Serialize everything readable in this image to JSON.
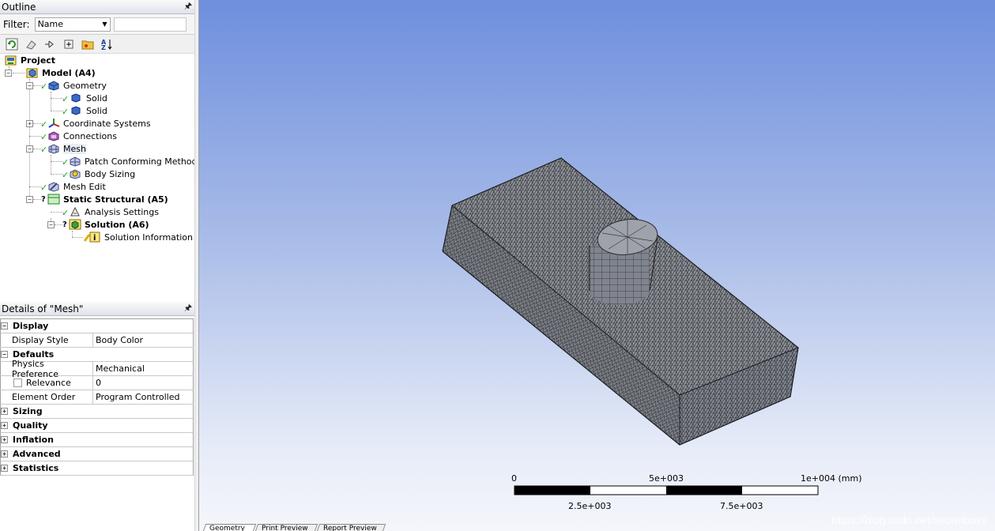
{
  "outline": {
    "title": "Outline",
    "filter_label": "Filter:",
    "filter_value": "Name",
    "filter_text": ""
  },
  "tree": [
    {
      "label": "Project",
      "bold": true,
      "icon": "project-icon"
    },
    {
      "label": "Model (A4)",
      "bold": true,
      "icon": "model-icon"
    },
    {
      "label": "Geometry",
      "bold": false,
      "icon": "geometry-icon"
    },
    {
      "label": "Solid",
      "bold": false,
      "icon": "solid-body-icon"
    },
    {
      "label": "Solid",
      "bold": false,
      "icon": "solid-body-icon"
    },
    {
      "label": "Coordinate Systems",
      "bold": false,
      "icon": "coordinate-systems-icon"
    },
    {
      "label": "Connections",
      "bold": false,
      "icon": "connections-icon"
    },
    {
      "label": "Mesh",
      "bold": false,
      "icon": "mesh-icon"
    },
    {
      "label": "Patch Conforming Method",
      "bold": false,
      "icon": "mesh-method-icon"
    },
    {
      "label": "Body Sizing",
      "bold": false,
      "icon": "body-sizing-icon"
    },
    {
      "label": "Mesh Edit",
      "bold": false,
      "icon": "mesh-edit-icon"
    },
    {
      "label": "Static Structural (A5)",
      "bold": true,
      "icon": "static-structural-icon"
    },
    {
      "label": "Analysis Settings",
      "bold": false,
      "icon": "analysis-settings-icon"
    },
    {
      "label": "Solution (A6)",
      "bold": true,
      "icon": "solution-icon"
    },
    {
      "label": "Solution Information",
      "bold": false,
      "icon": "solution-information-icon"
    }
  ],
  "details": {
    "title": "Details of \"Mesh\"",
    "rows": [
      {
        "kind": "category",
        "label": "Display",
        "expanded": true
      },
      {
        "kind": "prop",
        "label": "Display Style",
        "value": "Body Color"
      },
      {
        "kind": "category",
        "label": "Defaults",
        "expanded": true
      },
      {
        "kind": "prop",
        "label": "Physics Preference",
        "value": "Mechanical"
      },
      {
        "kind": "prop-check",
        "label": "Relevance",
        "value": "0"
      },
      {
        "kind": "prop",
        "label": "Element Order",
        "value": "Program Controlled"
      },
      {
        "kind": "category",
        "label": "Sizing",
        "expanded": false
      },
      {
        "kind": "category",
        "label": "Quality",
        "expanded": false
      },
      {
        "kind": "category",
        "label": "Inflation",
        "expanded": false
      },
      {
        "kind": "category",
        "label": "Advanced",
        "expanded": false
      },
      {
        "kind": "category",
        "label": "Statistics",
        "expanded": false
      }
    ]
  },
  "scale_bar": {
    "top_labels": [
      "0",
      "5e+003",
      "1e+004 (mm)"
    ],
    "bottom_labels": [
      "2.5e+003",
      "7.5e+003"
    ]
  },
  "bottom_tabs": [
    "Geometry",
    "Print Preview",
    "Report Preview"
  ],
  "watermark": "https://blog.csdn.net/secretboys",
  "colors": {
    "viewport_top": "#6e8fde",
    "viewport_bottom": "#f4f6fb",
    "mesh_face": "#8a8d94",
    "check_green": "#1e9e1e"
  }
}
